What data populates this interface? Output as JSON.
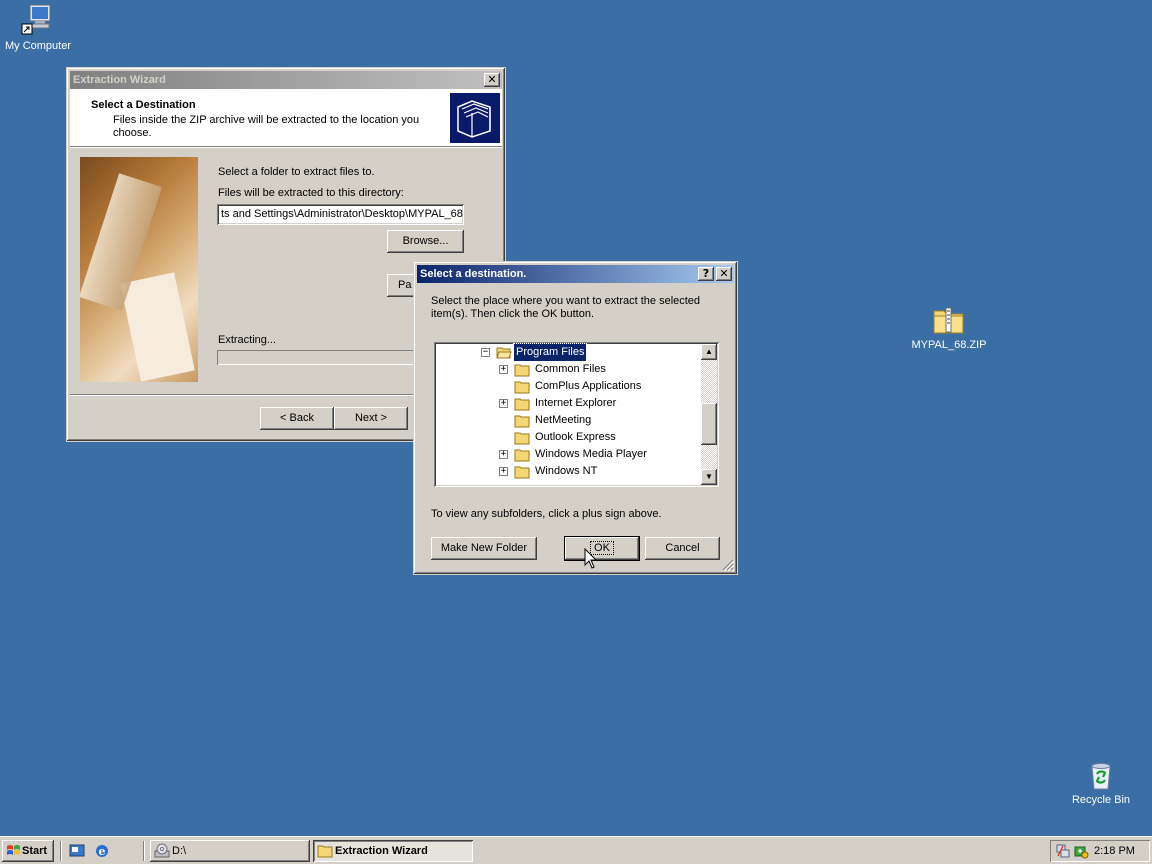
{
  "desktop": {
    "icons": [
      {
        "label": "My Computer"
      },
      {
        "label": "MYPAL_68.ZIP"
      },
      {
        "label": "Recycle Bin"
      }
    ]
  },
  "wizard": {
    "title": "Extraction Wizard",
    "header_title": "Select a Destination",
    "header_desc": "Files inside the ZIP archive will be extracted to the location you choose.",
    "prompt": "Select a folder to extract files to.",
    "dir_label": "Files will be extracted to this directory:",
    "dir_value": "ts and Settings\\Administrator\\Desktop\\MYPAL_68",
    "browse_label": "Browse...",
    "password_label": "Pa",
    "extracting_label": "Extracting...",
    "back_label": "< Back",
    "next_label": "Next >"
  },
  "dialog": {
    "title": "Select a destination.",
    "instructions": "Select the place where you want to extract the selected item(s).  Then click the OK button.",
    "tree": [
      {
        "label": "Program Files",
        "expander": "−",
        "selected": true
      },
      {
        "label": "Common Files",
        "expander": "+"
      },
      {
        "label": "ComPlus Applications",
        "expander": ""
      },
      {
        "label": "Internet Explorer",
        "expander": "+"
      },
      {
        "label": "NetMeeting",
        "expander": ""
      },
      {
        "label": "Outlook Express",
        "expander": ""
      },
      {
        "label": "Windows Media Player",
        "expander": "+"
      },
      {
        "label": "Windows NT",
        "expander": "+"
      }
    ],
    "hint": "To view any subfolders, click a plus sign above.",
    "make_folder_label": "Make New Folder",
    "ok_label": "OK",
    "cancel_label": "Cancel"
  },
  "taskbar": {
    "start_label": "Start",
    "tasks": [
      {
        "label": "D:\\"
      },
      {
        "label": "Extraction Wizard"
      }
    ],
    "clock": "2:18 PM"
  }
}
